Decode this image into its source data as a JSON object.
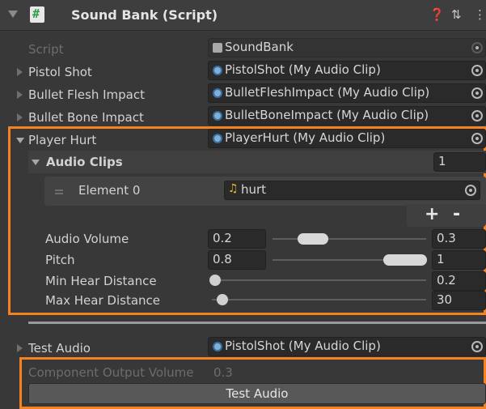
{
  "header": {
    "title": "Sound Bank (Script)",
    "help_icon": "help-icon",
    "settings_icon": "preset-sliders-icon",
    "menu_icon": "kebab-menu-icon"
  },
  "script_field": {
    "label": "Script",
    "value": "SoundBank"
  },
  "fields": [
    {
      "label": "Pistol Shot",
      "value": "PistolShot (My Audio Clip)"
    },
    {
      "label": "Bullet Flesh Impact",
      "value": "BulletFleshImpact (My Audio Clip)"
    },
    {
      "label": "Bullet Bone Impact",
      "value": "BulletBoneImpact (My Audio Clip)"
    }
  ],
  "player_hurt": {
    "label": "Player Hurt",
    "value": "PlayerHurt (My Audio Clip)",
    "audio_clips": {
      "label": "Audio Clips",
      "count": "1",
      "element_label": "Element 0",
      "element_value": "hurt",
      "add": "+",
      "remove": "-"
    },
    "audio_volume": {
      "label": "Audio Volume",
      "min": "0.2",
      "max": "0.3"
    },
    "pitch": {
      "label": "Pitch",
      "min": "0.8",
      "max": "1"
    },
    "min_hear_distance": {
      "label": "Min Hear Distance",
      "value": "0.2"
    },
    "max_hear_distance": {
      "label": "Max Hear Distance",
      "value": "30"
    }
  },
  "test_audio": {
    "label": "Test Audio",
    "value": "PistolShot (My Audio Clip)"
  },
  "output_volume": {
    "label": "Component Output Volume",
    "value": "0.3"
  },
  "test_button": {
    "label": "Test Audio"
  },
  "colors": {
    "highlight": "#f58220",
    "background": "#383838"
  }
}
